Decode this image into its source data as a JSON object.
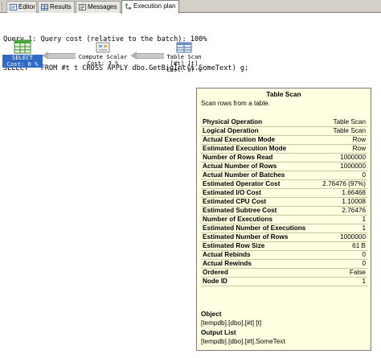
{
  "tabs": [
    {
      "label": "Editor",
      "icon": "editor-icon",
      "active": false
    },
    {
      "label": "Results",
      "icon": "results-grid-icon",
      "active": false
    },
    {
      "label": "Messages",
      "icon": "messages-icon",
      "active": false
    },
    {
      "label": "Execution plan",
      "icon": "execution-plan-icon",
      "active": true
    }
  ],
  "query": {
    "line1": "Query 1: Query cost (relative to the batch): 100%",
    "line2": "SELECT * FROM #t t CROSS APPLY dbo.GetBigInt(t.SomeText) g;"
  },
  "plan": {
    "select": {
      "line1": "SELECT",
      "line2": "Cost: 0 %",
      "icon": "select-operator-icon"
    },
    "compute_scalar": {
      "line1": "Compute Scalar",
      "line2": "Cost: 3 %",
      "icon": "compute-scalar-icon"
    },
    "table_scan": {
      "line1": "Table Scan",
      "line2": "[#t] [t]",
      "line3": "Cost: 97 %",
      "icon": "table-scan-icon"
    }
  },
  "tooltip": {
    "title": "Table Scan",
    "description": "Scan rows from a table.",
    "rows": [
      {
        "k": "Physical Operation",
        "v": "Table Scan"
      },
      {
        "k": "Logical Operation",
        "v": "Table Scan"
      },
      {
        "k": "Actual Execution Mode",
        "v": "Row"
      },
      {
        "k": "Estimated Execution Mode",
        "v": "Row"
      },
      {
        "k": "Number of Rows Read",
        "v": "1000000"
      },
      {
        "k": "Actual Number of Rows",
        "v": "1000000"
      },
      {
        "k": "Actual Number of Batches",
        "v": "0"
      },
      {
        "k": "Estimated Operator Cost",
        "v": "2.76476 (97%)"
      },
      {
        "k": "Estimated I/O Cost",
        "v": "1.66468"
      },
      {
        "k": "Estimated CPU Cost",
        "v": "1.10008"
      },
      {
        "k": "Estimated Subtree Cost",
        "v": "2.76476"
      },
      {
        "k": "Number of Executions",
        "v": "1"
      },
      {
        "k": "Estimated Number of Executions",
        "v": "1"
      },
      {
        "k": "Estimated Number of Rows",
        "v": "1000000"
      },
      {
        "k": "Estimated Row Size",
        "v": "61 B"
      },
      {
        "k": "Actual Rebinds",
        "v": "0"
      },
      {
        "k": "Actual Rewinds",
        "v": "0"
      },
      {
        "k": "Ordered",
        "v": "False"
      },
      {
        "k": "Node ID",
        "v": "1"
      }
    ],
    "object_label": "Object",
    "object_value": "[tempdb].[dbo].[#t] [t]",
    "output_label": "Output List",
    "output_value": "[tempdb].[dbo].[#t].SomeText"
  }
}
